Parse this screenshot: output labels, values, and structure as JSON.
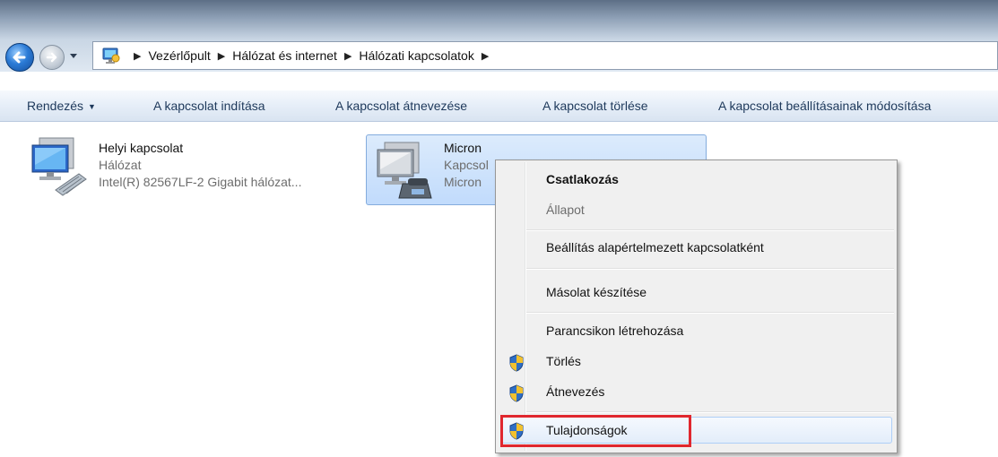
{
  "breadcrumb": [
    "Vezérlőpult",
    "Hálózat és internet",
    "Hálózati kapcsolatok"
  ],
  "commands": {
    "organize": "Rendezés",
    "start": "A kapcsolat indítása",
    "rename": "A kapcsolat átnevezése",
    "delete": "A kapcsolat törlése",
    "change_settings": "A kapcsolat beállításainak módosítása"
  },
  "connections": [
    {
      "name": "Helyi kapcsolat",
      "status": "Hálózat",
      "device": "Intel(R) 82567LF-2 Gigabit hálózat...",
      "icon": "network-adapter-icon"
    },
    {
      "name": "Micron",
      "status": "Kapcsol",
      "device": "Micron",
      "icon": "dialup-modem-icon",
      "selected": true
    }
  ],
  "context_menu": {
    "connect": "Csatlakozás",
    "status": "Állapot",
    "set_default": "Beállítás alapértelmezett kapcsolatként",
    "copy": "Másolat készítése",
    "create_shortcut": "Parancsikon létrehozása",
    "delete": "Törlés",
    "rename": "Átnevezés",
    "properties": "Tulajdonságok"
  },
  "colors": {
    "command_text": "#1e395b",
    "highlight_border": "#e0272e",
    "selection": "#c1dbfc"
  }
}
